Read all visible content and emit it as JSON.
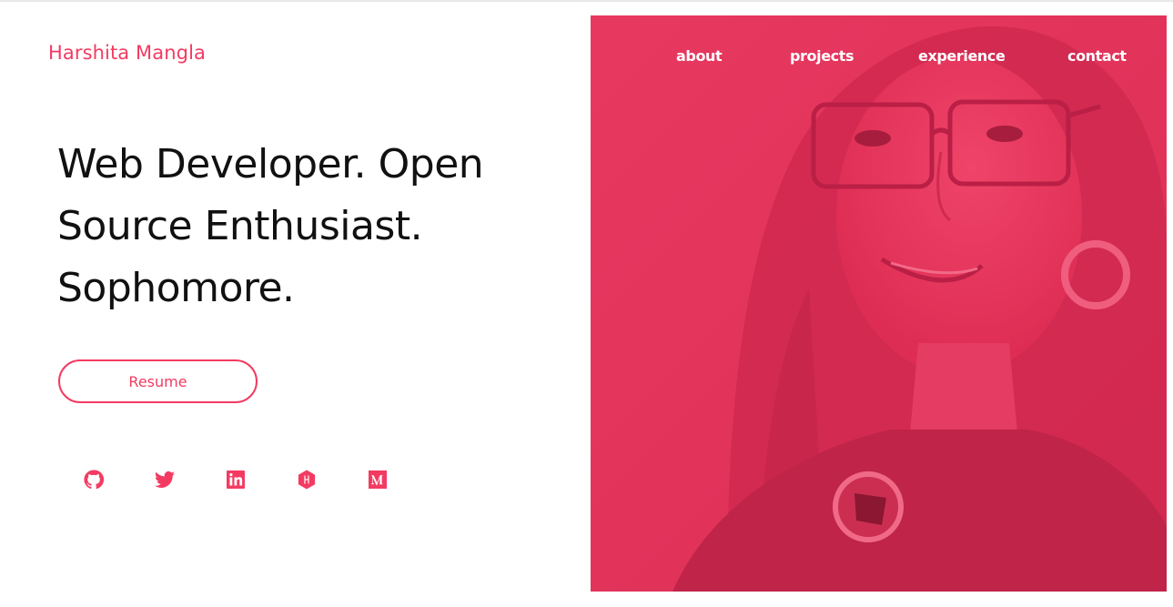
{
  "brand": {
    "name": "Harshita Mangla"
  },
  "nav": {
    "items": [
      {
        "label": "about"
      },
      {
        "label": "projects"
      },
      {
        "label": "experience"
      },
      {
        "label": "contact"
      }
    ]
  },
  "hero": {
    "headline": "Web Developer. Open Source Enthusiast. Sophomore.",
    "resume_label": "Resume",
    "photo_alt": "portrait-photo"
  },
  "socials": [
    {
      "icon": "github-icon"
    },
    {
      "icon": "twitter-icon"
    },
    {
      "icon": "linkedin-icon"
    },
    {
      "icon": "hashnode-icon"
    },
    {
      "icon": "medium-icon"
    }
  ],
  "colors": {
    "accent": "#f33b62",
    "overlay": "#e0315a",
    "text": "#111111"
  }
}
